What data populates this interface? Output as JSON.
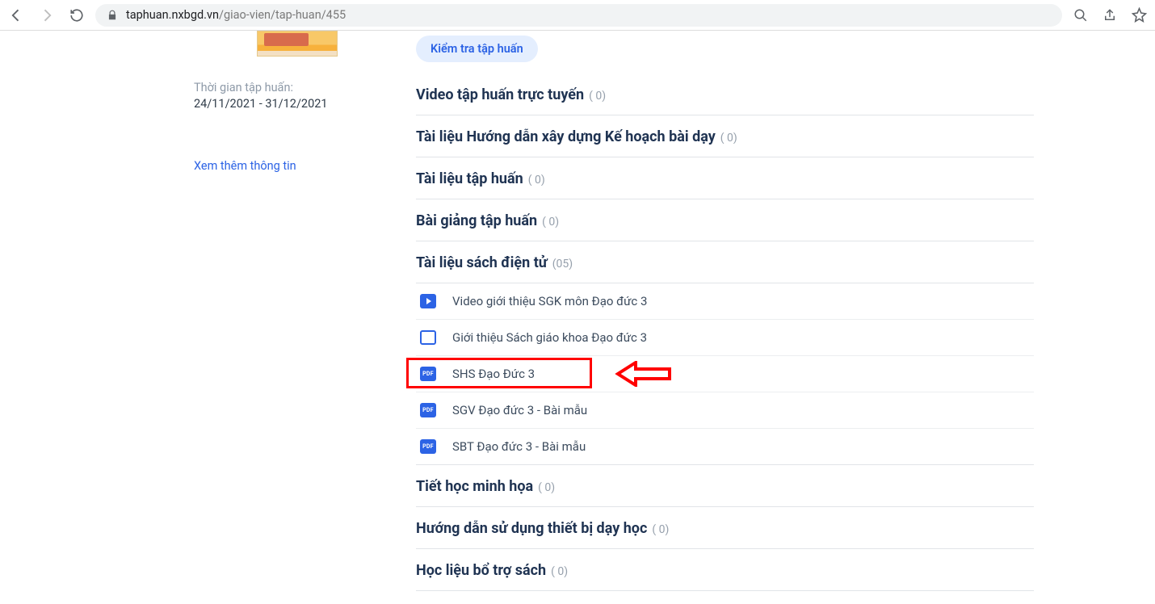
{
  "browser": {
    "url_domain": "taphuan.nxbgd.vn",
    "url_path": "/giao-vien/tap-huan/455"
  },
  "sidebar": {
    "time_label": "Thời gian tập huấn:",
    "time_range": "24/11/2021 - 31/12/2021",
    "more_info": "Xem thêm thông tin"
  },
  "pill": "Kiểm tra tập huấn",
  "sections": [
    {
      "title": "Video tập huấn trực tuyến",
      "count": "( 0)"
    },
    {
      "title": "Tài liệu Hướng dẫn xây dựng Kế hoạch bài dạy",
      "count": "( 0)"
    },
    {
      "title": "Tài liệu tập huấn",
      "count": "( 0)"
    },
    {
      "title": "Bài giảng tập huấn",
      "count": "( 0)"
    },
    {
      "title": "Tài liệu sách điện tử",
      "count": "(05)"
    }
  ],
  "items": [
    {
      "icon": "play",
      "label": "Video giới thiệu SGK môn Đạo đức 3"
    },
    {
      "icon": "slides",
      "label": "Giới thiệu Sách giáo khoa Đạo đức 3"
    },
    {
      "icon": "pdf",
      "label": "SHS Đạo Đức 3",
      "highlighted": true
    },
    {
      "icon": "pdf",
      "label": "SGV Đạo đức 3 - Bài mẫu"
    },
    {
      "icon": "pdf",
      "label": "SBT Đạo đức 3 - Bài mẫu"
    }
  ],
  "sections_after": [
    {
      "title": "Tiết học minh họa",
      "count": "( 0)"
    },
    {
      "title": "Hướng dẫn sử dụng thiết bị dạy học",
      "count": "( 0)"
    },
    {
      "title": "Học liệu bổ trợ sách",
      "count": "( 0)"
    }
  ],
  "pdf_text": "PDF"
}
